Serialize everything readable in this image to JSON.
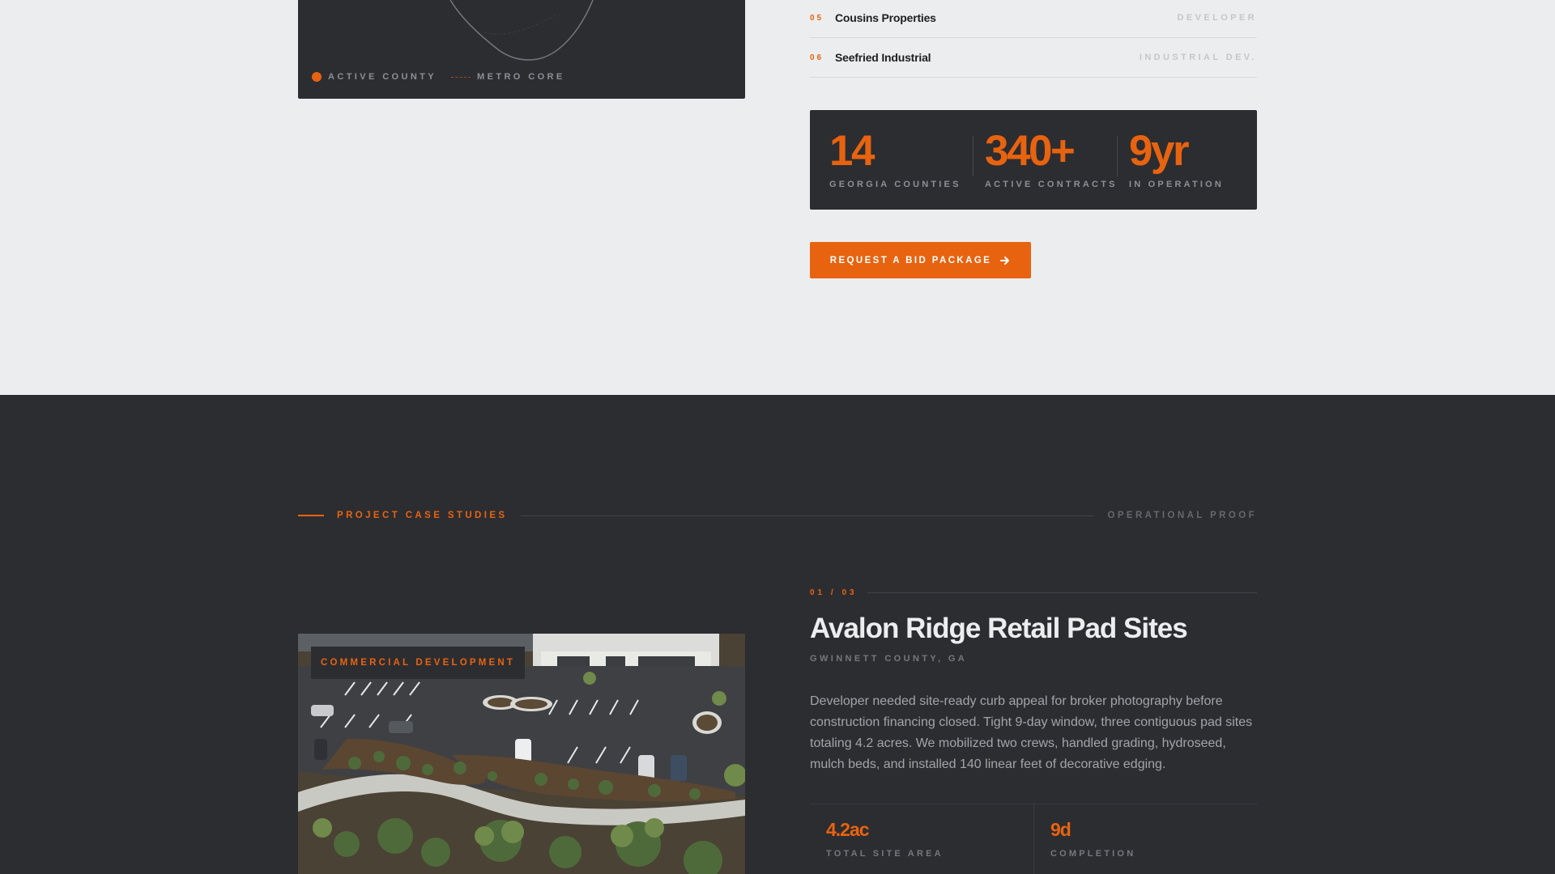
{
  "map": {
    "legend": {
      "active_label": "ACTIVE COUNTY",
      "metro_label": "METRO CORE"
    },
    "colors": {
      "active": "#e8630f",
      "metro": "#9b4d1c",
      "outline": "#77787d"
    }
  },
  "clients": [
    {
      "num": "05",
      "name": "Cousins Properties",
      "role": "DEVELOPER"
    },
    {
      "num": "06",
      "name": "Seefried Industrial",
      "role": "INDUSTRIAL DEV."
    }
  ],
  "stats": [
    {
      "value": "14",
      "label": "GEORGIA COUNTIES"
    },
    {
      "value": "340+",
      "label": "ACTIVE CONTRACTS"
    },
    {
      "value": "9yr",
      "label": "IN OPERATION"
    }
  ],
  "cta": {
    "label": "REQUEST A BID PACKAGE",
    "icon": "arrow-right-icon"
  },
  "case_section": {
    "label": "PROJECT CASE STUDIES",
    "right_label": "OPERATIONAL PROOF",
    "counter": "01 / 03",
    "badge": "COMMERCIAL DEVELOPMENT",
    "title": "Avalon Ridge Retail Pad Sites",
    "location": "GWINNETT COUNTY, GA",
    "description": "Developer needed site-ready curb appeal for broker photography before construction financing closed. Tight 9-day window, three contiguous pad sites totaling 4.2 acres. We mobilized two crews, handled grading, hydroseed, mulch beds, and installed 140 linear feet of decorative edging.",
    "stats": [
      {
        "value": "4.2ac",
        "label": "TOTAL SITE AREA"
      },
      {
        "value": "9d",
        "label": "COMPLETION"
      }
    ]
  },
  "colors": {
    "accent": "#e8630f",
    "dark": "#2c2d31",
    "light": "#ecedee"
  }
}
